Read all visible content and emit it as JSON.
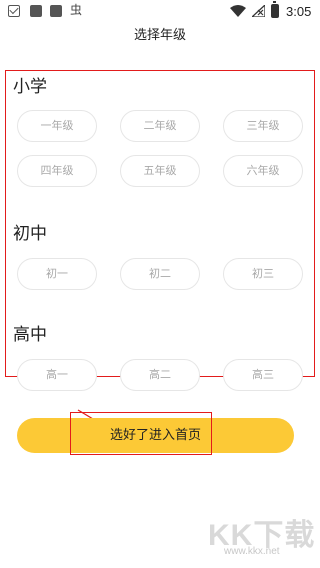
{
  "status_bar": {
    "time": "3:05",
    "icons": [
      "mail-icon",
      "app-icon",
      "app-icon",
      "bug-icon",
      "wifi-icon",
      "signal-off-icon",
      "battery-icon"
    ],
    "bug_glyph": "虫"
  },
  "page": {
    "title": "选择年级"
  },
  "sections": {
    "primary": {
      "title": "小学",
      "grades": [
        "一年级",
        "二年级",
        "三年级",
        "四年级",
        "五年级",
        "六年级"
      ]
    },
    "junior": {
      "title": "初中",
      "grades": [
        "初一",
        "初二",
        "初三"
      ]
    },
    "senior": {
      "title": "高中",
      "grades": [
        "高一",
        "高二",
        "高三"
      ]
    }
  },
  "submit": {
    "label": "选好了进入首页"
  },
  "annotation_color": "#e21b1b",
  "button_color": "#fcc936",
  "watermark": {
    "big": "KK下载",
    "url": "www.kkx.net"
  }
}
